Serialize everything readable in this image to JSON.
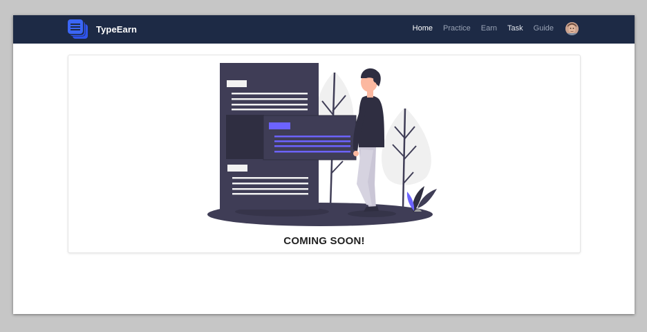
{
  "brand": {
    "name": "TypeEarn",
    "logo_icon": "stacked-documents-icon"
  },
  "nav": {
    "items": [
      {
        "label": "Home",
        "active": true
      },
      {
        "label": "Practice",
        "active": false
      },
      {
        "label": "Earn",
        "active": false
      },
      {
        "label": "Task",
        "active": false
      },
      {
        "label": "Guide",
        "active": false
      }
    ],
    "avatar_icon": "user-avatar-icon"
  },
  "main": {
    "message": "COMING SOON!",
    "illustration": "person-next-to-documents-illustration"
  },
  "colors": {
    "navbar": "#1d2a45",
    "accent": "#6c63ff",
    "logo": "#2f54eb",
    "doc_dark": "#3f3d56",
    "window_bg": "#ffffff",
    "backdrop": "#c6c6c6"
  }
}
